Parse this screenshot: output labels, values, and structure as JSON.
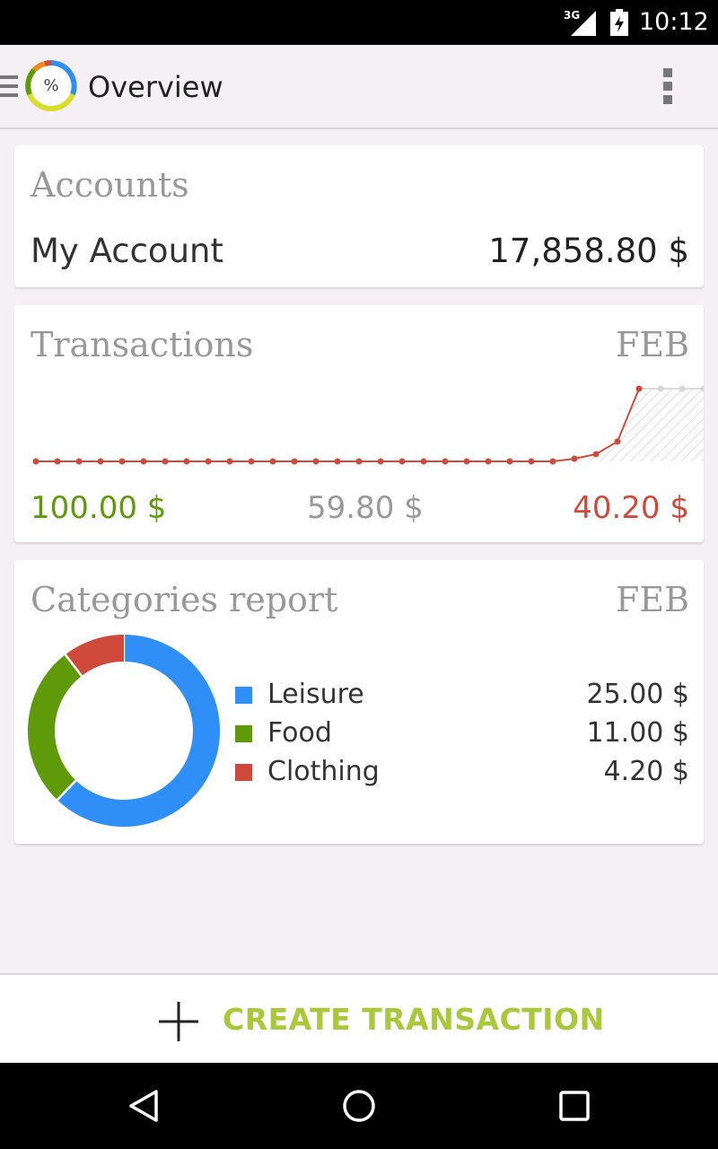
{
  "status_bar": {
    "network": "3G",
    "time": "10:12"
  },
  "app_bar": {
    "logo_text": "%",
    "title": "Overview"
  },
  "accounts": {
    "title": "Accounts",
    "items": [
      {
        "name": "My Account",
        "balance": "17,858.80 $"
      }
    ]
  },
  "transactions": {
    "title": "Transactions",
    "month": "FEB",
    "income": "100.00 $",
    "balance": "59.80 $",
    "expense": "40.20 $",
    "colors": {
      "income": "#5e9a0a",
      "expense": "#d04a3c",
      "neutral": "#999999"
    }
  },
  "categories": {
    "title": "Categories report",
    "month": "FEB",
    "items": [
      {
        "label": "Leisure",
        "value": "25.00 $",
        "amount": 25.0,
        "color": "#2f8ff7"
      },
      {
        "label": "Food",
        "value": "11.00 $",
        "amount": 11.0,
        "color": "#5e9a0a"
      },
      {
        "label": "Clothing",
        "value": "4.20 $",
        "amount": 4.2,
        "color": "#d04a3c"
      }
    ]
  },
  "action": {
    "create_label": "CREATE TRANSACTION",
    "accent": "#a9c93a"
  },
  "chart_data": {
    "type": "line",
    "title": "Transactions",
    "x": [
      1,
      2,
      3,
      4,
      5,
      6,
      7,
      8,
      9,
      10,
      11,
      12,
      13,
      14,
      15,
      16,
      17,
      18,
      19,
      20,
      21,
      22,
      23,
      24,
      25,
      26,
      27,
      28,
      29,
      30,
      31,
      32
    ],
    "series": [
      {
        "values": [
          0,
          0,
          0,
          0,
          0,
          0,
          0,
          0,
          0,
          0,
          0,
          0,
          0,
          0,
          0,
          0,
          0,
          0,
          0,
          0,
          0,
          0,
          0,
          0,
          0,
          1.5,
          4,
          11,
          40.2
        ],
        "color": "#d04a3c"
      },
      {
        "values": [
          null,
          null,
          null,
          null,
          null,
          null,
          null,
          null,
          null,
          null,
          null,
          null,
          null,
          null,
          null,
          null,
          null,
          null,
          null,
          null,
          null,
          null,
          null,
          null,
          null,
          null,
          null,
          null,
          40.2,
          40.2,
          40.2,
          40.2,
          40.2
        ],
        "color": "#cccccc"
      }
    ],
    "ylim": [
      0,
      40.2
    ],
    "grid": false
  }
}
